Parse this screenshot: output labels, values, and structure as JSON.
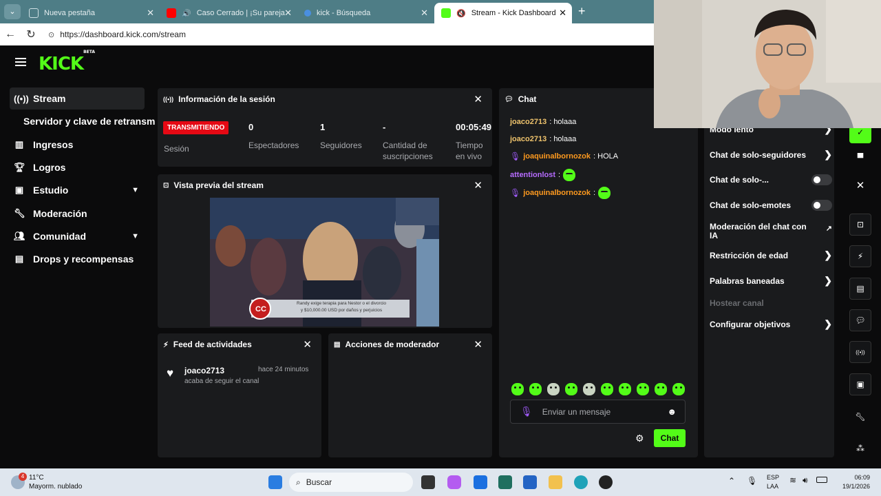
{
  "browser": {
    "tabs": [
      {
        "title": "Nueva pestaña",
        "active": false
      },
      {
        "title": "Caso Cerrado | ¡Su pareja cre",
        "active": false
      },
      {
        "title": "kick - Búsqueda",
        "active": false
      },
      {
        "title": "Stream - Kick Dashboard",
        "active": true
      }
    ],
    "url": "https://dashboard.kick.com/stream"
  },
  "app": {
    "logo": "KICK",
    "logo_badge": "BETA"
  },
  "sidebar": {
    "items": [
      {
        "label": "Stream",
        "icon": "broadcast-icon"
      },
      {
        "label": "Servidor y clave de retransm",
        "icon": ""
      },
      {
        "label": "Ingresos",
        "icon": "chart-icon"
      },
      {
        "label": "Logros",
        "icon": "trophy-icon"
      },
      {
        "label": "Estudio",
        "icon": "studio-icon"
      },
      {
        "label": "Moderación",
        "icon": "wrench-icon"
      },
      {
        "label": "Comunidad",
        "icon": "people-icon"
      },
      {
        "label": "Drops y recompensas",
        "icon": "gift-icon"
      }
    ]
  },
  "session": {
    "title": "Información de la sesión",
    "live_badge": "TRANSMITIENDO",
    "session_label": "Sesión",
    "stats": [
      {
        "value": "0",
        "label": "Espectadores"
      },
      {
        "value": "1",
        "label": "Seguidores"
      },
      {
        "value": "-",
        "label": "Cantidad de suscripciones"
      },
      {
        "value": "00:05:49",
        "label": "Tiempo en vivo"
      }
    ]
  },
  "preview": {
    "title": "Vista previa del stream",
    "lower_third_line1": "Randy exige terapia para Nestor o el divorcio",
    "lower_third_line2": "y $10,000.00 USD por daños y perjuicios"
  },
  "activity": {
    "title": "Feed de actividades",
    "items": [
      {
        "user": "joaco2713",
        "time": "hace 24 minutos",
        "text": "acaba de seguir el canal"
      }
    ]
  },
  "mod_actions": {
    "title": "Acciones de moderador"
  },
  "chat": {
    "title": "Chat",
    "messages": [
      {
        "user": "joaco2713",
        "text": ": holaaa",
        "color": "#f0c46d"
      },
      {
        "user": "joaco2713",
        "text": ": holaaa",
        "color": "#f0c46d"
      },
      {
        "user": "joaquinalbornozok",
        "text": ": HOLA",
        "color": "#ff9a1f"
      },
      {
        "user": "attentionlost",
        "text": ":",
        "color": "#b76cff"
      },
      {
        "user": "joaquinalbornozok",
        "text": ":",
        "color": "#ff9a1f"
      }
    ],
    "input_placeholder": "Enviar un mensaje",
    "send_label": "Chat"
  },
  "settings": {
    "rows": [
      {
        "label": "Modo lento",
        "control": "arrow"
      },
      {
        "label": "Chat de solo-seguidores",
        "control": "arrow"
      },
      {
        "label": "Chat de solo-...",
        "control": "toggle"
      },
      {
        "label": "Chat de solo-emotes",
        "control": "toggle"
      },
      {
        "label": "Moderación del chat con IA",
        "control": "external"
      },
      {
        "label": "Restricción de edad",
        "control": "arrow"
      },
      {
        "label": "Palabras baneadas",
        "control": "arrow"
      },
      {
        "label": "Hostear canal",
        "control": "none"
      },
      {
        "label": "Configurar objetivos",
        "control": "arrow"
      }
    ]
  },
  "taskbar": {
    "weather_temp": "11°C",
    "weather_desc": "Mayorm. nublado",
    "notif_count": "4",
    "search_placeholder": "Buscar",
    "lang_line1": "ESP",
    "lang_line2": "LAA",
    "time": "06:09",
    "date": "19/1/2026"
  },
  "colors": {
    "accent": "#53fc18",
    "live": "#e50914",
    "panel": "#1a1b1d"
  }
}
